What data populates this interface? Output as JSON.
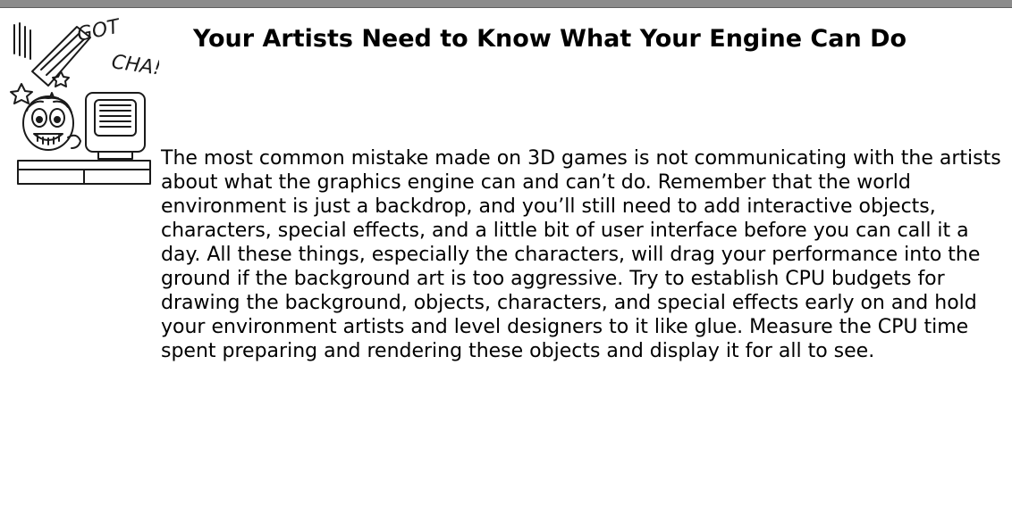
{
  "sidebar": {
    "icon": "gotcha-cartoon-icon",
    "icon_text": "GOTCHA!",
    "title": "Your Artists Need to Know What Your Engine Can Do",
    "body": "The most common mistake made on 3D games is not communicating with the artists about what the graphics engine can and can’t do. Remember that the world environment is just a backdrop, and you’ll still need to add interactive objects, characters, special effects, and a little bit of user interface before you can call it a day. All these things, especially the characters, will drag your performance into the ground if the background art is too aggressive. Try to establish CPU budgets for drawing the background, objects, characters, and special effects early on and hold your environment artists and level designers to it like glue. Measure the CPU time spent preparing and rendering these objects and display it for all to see."
  },
  "colors": {
    "rule": "#8c8c8c",
    "text": "#000000",
    "background": "#ffffff"
  }
}
